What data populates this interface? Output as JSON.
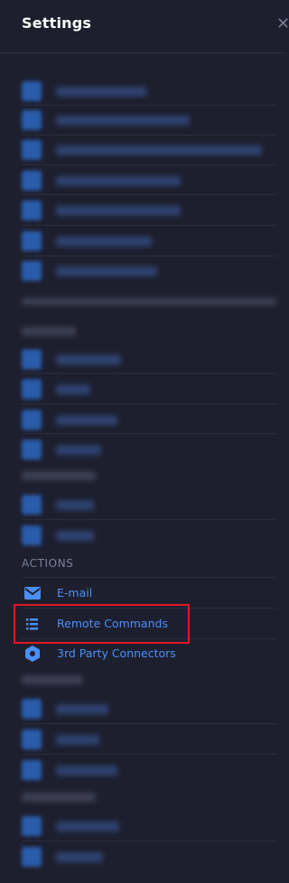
{
  "header": {
    "title": "Settings",
    "close_glyph": "✕"
  },
  "actions": {
    "section_label": "ACTIONS",
    "items": [
      {
        "label": "E-mail",
        "icon": "envelope-icon"
      },
      {
        "label": "Remote Commands",
        "icon": "list-icon"
      },
      {
        "label": "3rd Party Connectors",
        "icon": "hexagon-icon"
      }
    ]
  },
  "colors": {
    "accent": "#4b8ff7",
    "highlight": "#e01820",
    "background": "#1e1f2e"
  }
}
